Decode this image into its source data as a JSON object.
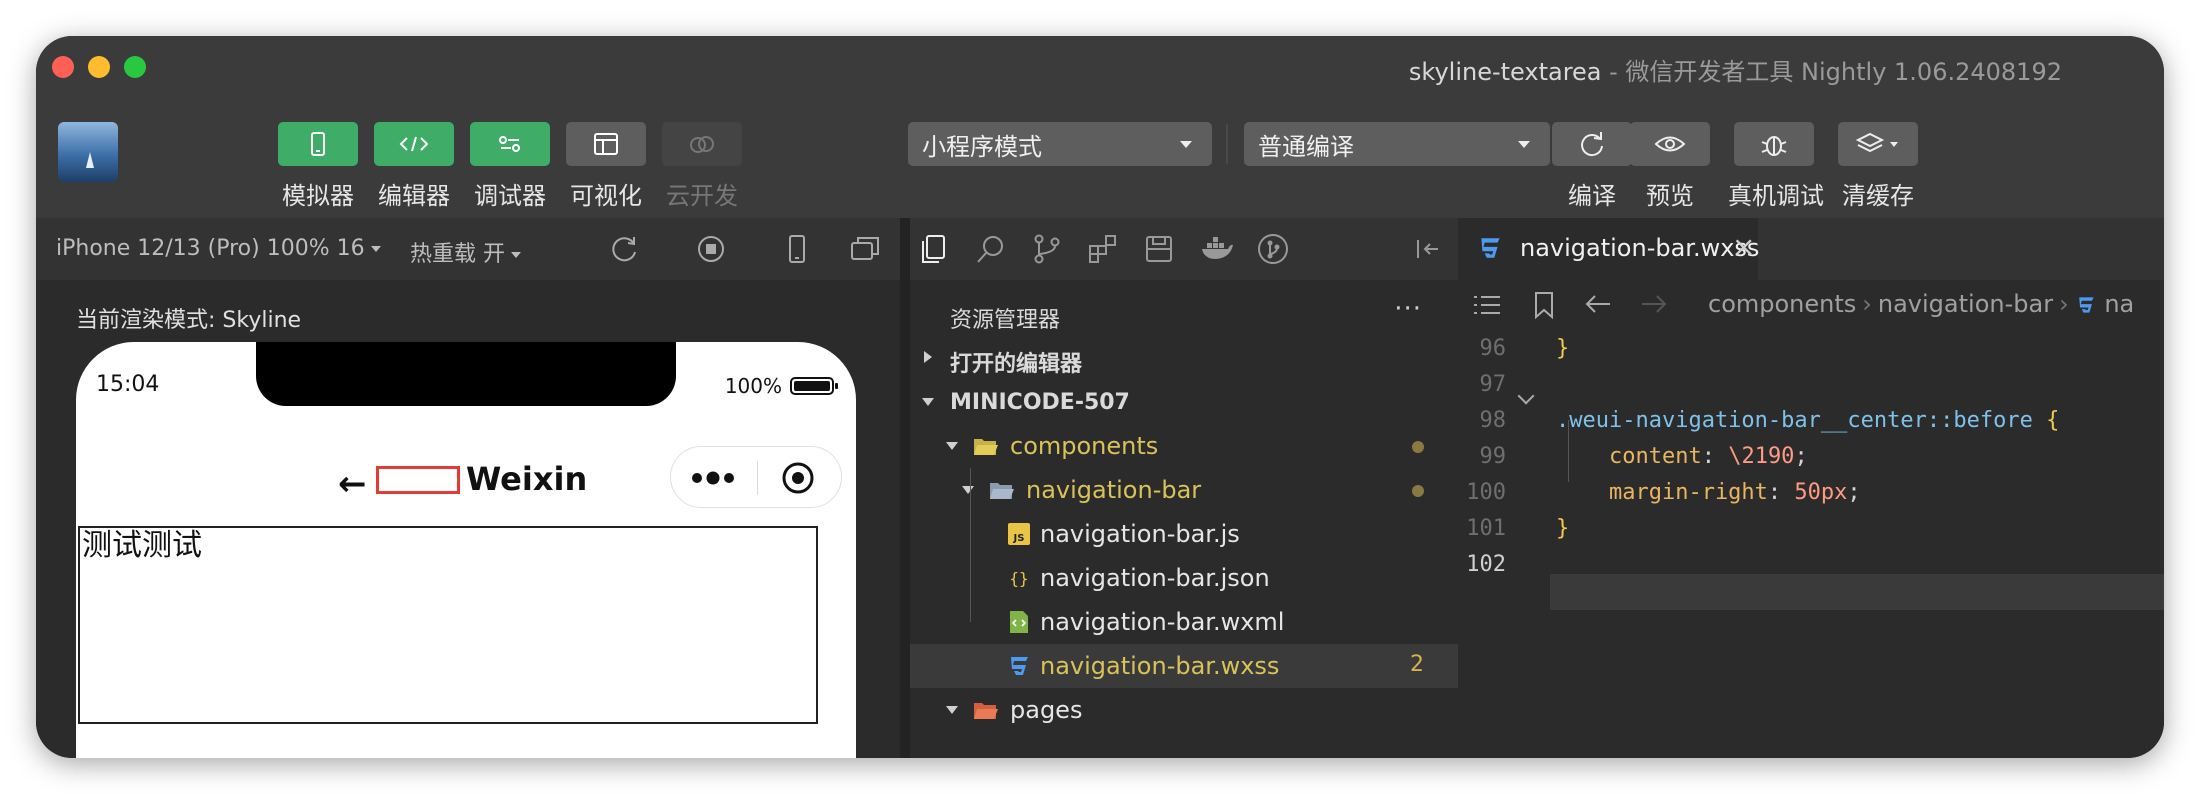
{
  "window": {
    "title": "skyline-textarea",
    "subtitle": " - 微信开发者工具 Nightly 1.06.2408192",
    "lights": [
      "#fe5f57",
      "#febc2e",
      "#28c840"
    ]
  },
  "toolbar": {
    "buttons": [
      {
        "label": "模拟器",
        "icon": "phone-icon"
      },
      {
        "label": "编辑器",
        "icon": "code-icon"
      },
      {
        "label": "调试器",
        "icon": "debugger-icon"
      },
      {
        "label": "可视化",
        "icon": "layout-icon"
      },
      {
        "label": "云开发",
        "icon": "cloud-icon"
      }
    ],
    "mode_select": "小程序模式",
    "compile_select": "普通编译",
    "right_buttons": [
      {
        "label": "编译",
        "icon": "refresh-icon"
      },
      {
        "label": "预览",
        "icon": "eye-icon"
      },
      {
        "label": "真机调试",
        "icon": "bug-icon"
      },
      {
        "label": "清缓存",
        "icon": "layers-icon"
      }
    ]
  },
  "simulator": {
    "device": "iPhone 12/13 (Pro) 100% 16",
    "hot_reload": "热重载 开",
    "render_mode": "当前渲染模式: Skyline",
    "time": "15:04",
    "battery": "100%",
    "nav_back": "←",
    "nav_title": "Weixin",
    "textarea_text": "测试测试"
  },
  "explorer": {
    "title": "资源管理器",
    "more": "···",
    "open_editors": "打开的编辑器",
    "project": "MINICODE-507",
    "folders": {
      "components": "components",
      "navigation_bar": "navigation-bar",
      "pages": "pages"
    },
    "files": [
      {
        "name": "navigation-bar.js",
        "type": "js"
      },
      {
        "name": "navigation-bar.json",
        "type": "json"
      },
      {
        "name": "navigation-bar.wxml",
        "type": "wxml"
      },
      {
        "name": "navigation-bar.wxss",
        "type": "wxss",
        "badge": "2"
      }
    ]
  },
  "editor": {
    "tab": "navigation-bar.wxss",
    "close": "×",
    "breadcrumb": [
      "components",
      "navigation-bar",
      "na"
    ],
    "lines": [
      {
        "n": "96",
        "tokens": [
          {
            "t": "}",
            "c": "c-brace"
          }
        ]
      },
      {
        "n": "97",
        "tokens": []
      },
      {
        "n": "98",
        "tokens": [
          {
            "t": ".weui-navigation-bar__center::before ",
            "c": "c-sel"
          },
          {
            "t": "{",
            "c": "c-brace"
          }
        ]
      },
      {
        "n": "99",
        "tokens": [
          {
            "t": "    content",
            "c": "c-prop"
          },
          {
            "t": ": ",
            "c": ""
          },
          {
            "t": "\\2190",
            "c": "c-num"
          },
          {
            "t": ";",
            "c": ""
          }
        ]
      },
      {
        "n": "100",
        "tokens": [
          {
            "t": "    margin-right",
            "c": "c-prop"
          },
          {
            "t": ": ",
            "c": ""
          },
          {
            "t": "50px",
            "c": "c-num"
          },
          {
            "t": ";",
            "c": ""
          }
        ]
      },
      {
        "n": "101",
        "tokens": [
          {
            "t": "}",
            "c": "c-brace"
          }
        ]
      },
      {
        "n": "102",
        "tokens": []
      }
    ]
  }
}
